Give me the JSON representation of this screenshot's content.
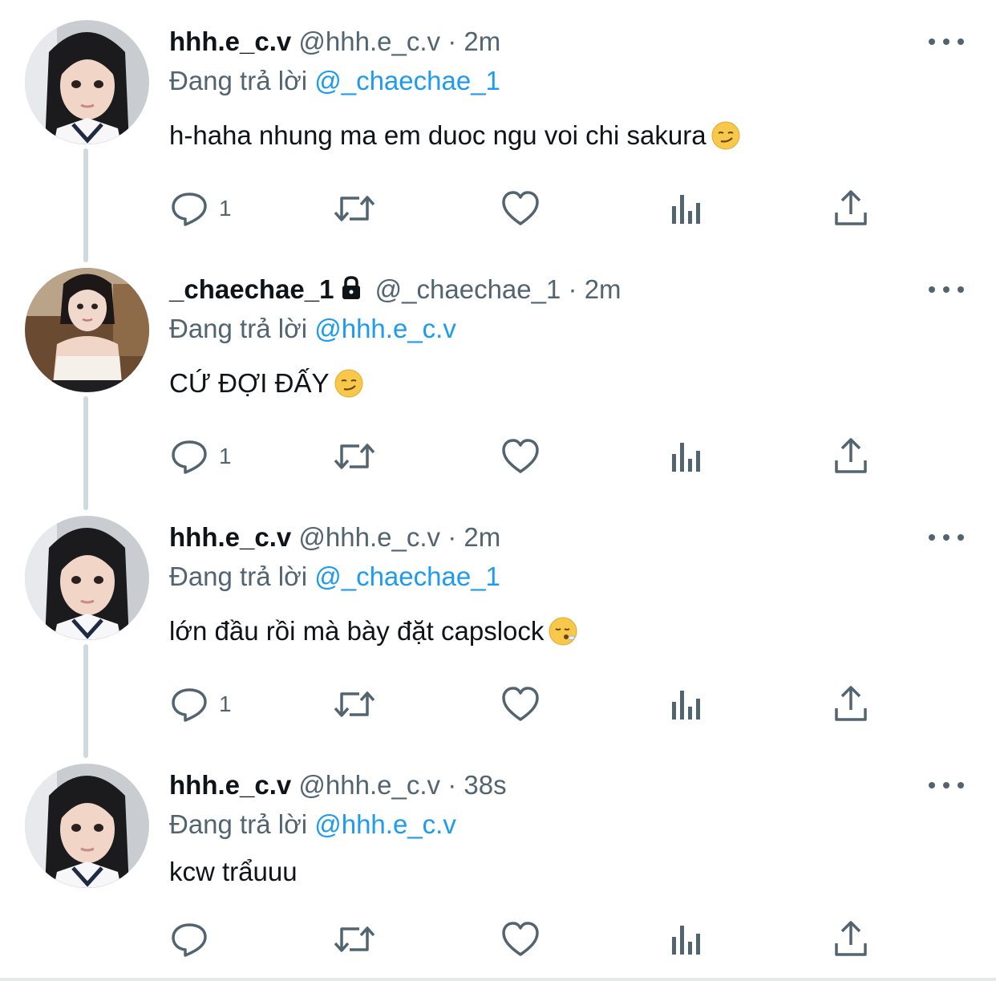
{
  "reply_prefix": "Đang trả lời",
  "tweets": [
    {
      "display_name": "hhh.e_c.v",
      "handle": "@hhh.e_c.v",
      "separator": "·",
      "time": "2m",
      "reply_to": "@_chaechae_1",
      "text": "h-haha nhung ma em duoc ngu voi chi sakura",
      "emoji": "smirk-emoji",
      "reply_count": "1",
      "locked": false
    },
    {
      "display_name": "_chaechae_1",
      "handle": "@_chaechae_1",
      "separator": "·",
      "time": "2m",
      "reply_to": "@hhh.e_c.v",
      "text": "CỨ ĐỢI ĐẤY",
      "emoji": "smirk-emoji",
      "reply_count": "1",
      "locked": true
    },
    {
      "display_name": "hhh.e_c.v",
      "handle": "@hhh.e_c.v",
      "separator": "·",
      "time": "2m",
      "reply_to": "@_chaechae_1",
      "text": "lớn đầu rồi mà bày đặt capslock",
      "emoji": "sigh-emoji",
      "reply_count": "1",
      "locked": false
    },
    {
      "display_name": "hhh.e_c.v",
      "handle": "@hhh.e_c.v",
      "separator": "·",
      "time": "38s",
      "reply_to": "@hhh.e_c.v",
      "text": "kcw trẩuuu",
      "emoji": "",
      "reply_count": "",
      "locked": false
    }
  ],
  "icons": {
    "reply": "reply-icon",
    "retweet": "retweet-icon",
    "like": "heart-icon",
    "views": "views-icon",
    "share": "share-icon",
    "more": "more-icon",
    "lock": "lock-icon"
  },
  "colors": {
    "mention": "#1d9bf0",
    "secondary_text": "#536471",
    "thread_line": "#cfd9de"
  }
}
